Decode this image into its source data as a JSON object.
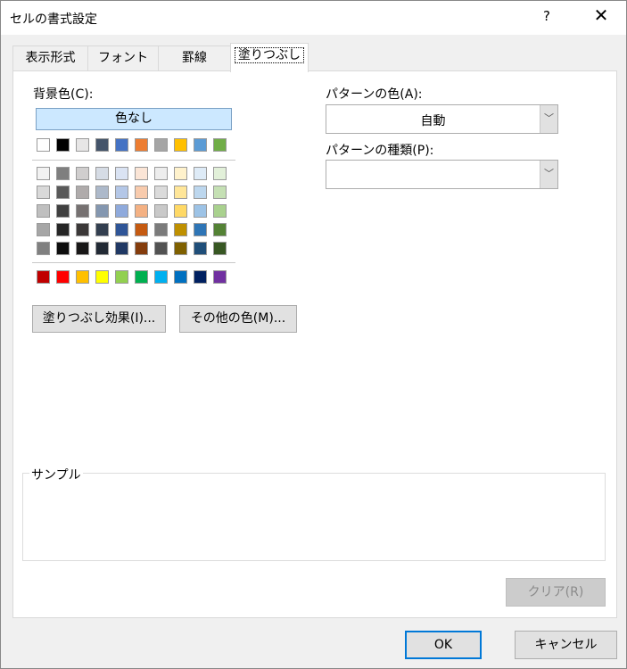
{
  "title": "セルの書式設定",
  "help_label": "?",
  "close_label": "✕",
  "tabs": [
    {
      "label": "表示形式"
    },
    {
      "label": "フォント"
    },
    {
      "label": "罫線"
    },
    {
      "label": "塗りつぶし",
      "active": true
    }
  ],
  "background": {
    "label": "背景色(C):",
    "no_color": "色なし",
    "theme_row": [
      "#FFFFFF",
      "#000000",
      "#E7E6E6",
      "#44546A",
      "#4472C4",
      "#ED7D31",
      "#A5A5A5",
      "#FFC000",
      "#5B9BD5",
      "#70AD47"
    ],
    "shades": [
      [
        "#F2F2F2",
        "#7F7F7F",
        "#D0CECE",
        "#D6DCE5",
        "#DAE3F3",
        "#FBE5D6",
        "#EDEDED",
        "#FFF2CC",
        "#DEEBF7",
        "#E2F0D9"
      ],
      [
        "#D9D9D9",
        "#595959",
        "#AFABAB",
        "#ADB9CA",
        "#B4C7E7",
        "#F8CBAD",
        "#DBDBDB",
        "#FFE699",
        "#BDD7EE",
        "#C5E0B4"
      ],
      [
        "#BFBFBF",
        "#404040",
        "#767171",
        "#8497B0",
        "#8FAADC",
        "#F4B183",
        "#C9C9C9",
        "#FFD966",
        "#9DC3E6",
        "#A9D18E"
      ],
      [
        "#A6A6A6",
        "#262626",
        "#3B3838",
        "#333F50",
        "#2F5597",
        "#C55A11",
        "#7B7B7B",
        "#BF9000",
        "#2E75B6",
        "#548235"
      ],
      [
        "#808080",
        "#0D0D0D",
        "#181717",
        "#222A35",
        "#203864",
        "#843C0C",
        "#525252",
        "#7F6000",
        "#1F4E79",
        "#385723"
      ]
    ],
    "standard": [
      "#C00000",
      "#FF0000",
      "#FFC000",
      "#FFFF00",
      "#92D050",
      "#00B050",
      "#00B0F0",
      "#0070C0",
      "#002060",
      "#7030A0"
    ]
  },
  "fill_effects_label": "塗りつぶし効果(I)...",
  "more_colors_label": "その他の色(M)...",
  "pattern_color": {
    "label": "パターンの色(A):",
    "value": "自動"
  },
  "pattern_style": {
    "label": "パターンの種類(P):",
    "value": ""
  },
  "sample_label": "サンプル",
  "clear_label": "クリア(R)",
  "ok_label": "OK",
  "cancel_label": "キャンセル"
}
